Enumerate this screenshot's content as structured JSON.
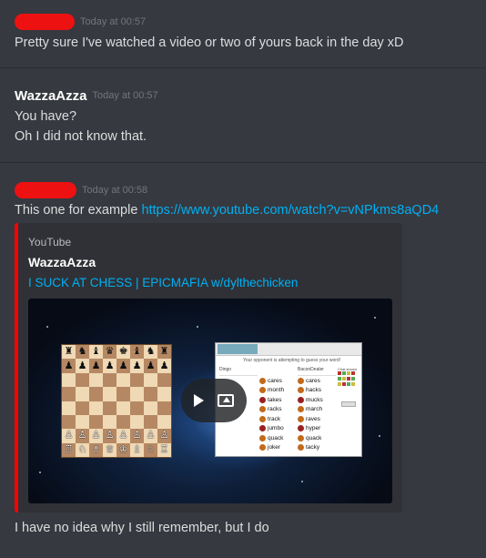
{
  "messages": [
    {
      "author": "",
      "timestamp": "Today at 00:57",
      "lines": [
        "Pretty sure I've watched a video or two of yours back in the day xD"
      ]
    },
    {
      "author": "WazzaAzza",
      "timestamp": "Today at 00:57",
      "lines": [
        "You have?",
        "Oh I did not know that."
      ]
    },
    {
      "author": "",
      "timestamp": "Today at 00:58",
      "text": "This one for example",
      "link": "https://www.youtube.com/watch?v=vNPkms8aQD4",
      "embed": {
        "provider": "YouTube",
        "author": "WazzaAzza",
        "title": "I SUCK AT CHESS | EPICMAFIA w/dylthechicken",
        "accent_color": "#ff0000",
        "thumbnail": {
          "board_rows": [
            [
              "♜",
              "♞",
              "♝",
              "♛",
              "♚",
              "♝",
              "♞",
              "♜"
            ],
            [
              "♟",
              "♟",
              "♟",
              "♟",
              "♟",
              "♟",
              "♟",
              "♟"
            ],
            [
              "",
              "",
              "",
              "",
              "",
              "",
              "",
              ""
            ],
            [
              "",
              "",
              "",
              "",
              "",
              "",
              "",
              ""
            ],
            [
              "",
              "",
              "",
              "",
              "",
              "",
              "",
              ""
            ],
            [
              "",
              "",
              "",
              "",
              "",
              "",
              "",
              ""
            ],
            [
              "♙",
              "♙",
              "♙",
              "♙",
              "♙",
              "♙",
              "♙",
              "♙"
            ],
            [
              "♖",
              "♘",
              "♗",
              "♕",
              "♔",
              "♗",
              "♘",
              "♖"
            ]
          ],
          "game_message": "Your opponent is attempting to guess your word!",
          "col_left_head": "Dingo",
          "col_right_head": "BaconDealer",
          "words_left": [
            "cares",
            "month",
            "takes",
            "racks",
            "track",
            "jumbo",
            "quack",
            "joker"
          ],
          "words_right": [
            "cares",
            "hacks",
            "mucks",
            "march",
            "raves",
            "hyper",
            "quack",
            "tacky"
          ],
          "side_label": "Chat shown"
        }
      },
      "lines_after": [
        "I have no idea why I still remember, but I do"
      ]
    }
  ],
  "colors": {
    "background": "#36393f",
    "link": "#00b0f4",
    "redaction": "#ee1111"
  }
}
